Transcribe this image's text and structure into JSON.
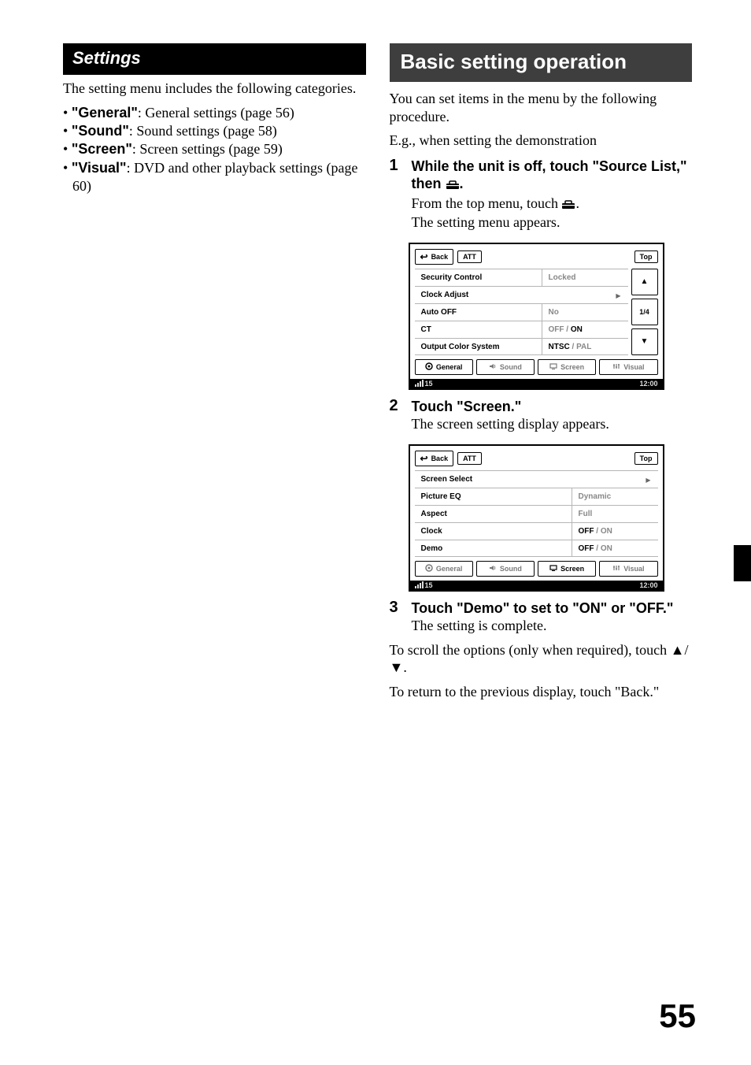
{
  "left": {
    "section_title": "Settings",
    "intro": "The setting menu includes the following categories.",
    "items": [
      {
        "name": "\"General\"",
        "desc": ": General settings (page 56)"
      },
      {
        "name": "\"Sound\"",
        "desc": ": Sound settings (page 58)"
      },
      {
        "name": "\"Screen\"",
        "desc": ": Screen settings (page 59)"
      },
      {
        "name": "\"Visual\"",
        "desc": ": DVD and other playback settings (page 60)"
      }
    ]
  },
  "right": {
    "main_title": "Basic setting operation",
    "intro1": "You can set items in the menu by the following procedure.",
    "intro2": "E.g., when setting the demonstration",
    "step1_head_a": "While the unit is off, touch \"Source List,\" then ",
    "step1_head_b": ".",
    "step1_body_a": "From the top menu, touch ",
    "step1_body_b": ".",
    "step1_body2": "The setting menu appears.",
    "step2_head": "Touch \"Screen.\"",
    "step2_body": "The screen setting display appears.",
    "step3_head": "Touch \"Demo\" to set to \"ON\" or \"OFF.\"",
    "step3_body": "The setting is complete.",
    "footer1": "To scroll the options (only when required), touch ▲/▼.",
    "footer2": "To return to the previous display, touch \"Back.\""
  },
  "shot_common": {
    "back": "Back",
    "att": "ATT",
    "top": "Top",
    "tabs": {
      "general": "General",
      "sound": "Sound",
      "screen": "Screen",
      "visual": "Visual"
    },
    "signal": "15",
    "clock": "12:00"
  },
  "shot1": {
    "rows": [
      {
        "name": "Security Control",
        "value": "Locked",
        "value_mode": "dim"
      },
      {
        "name": "Clock Adjust",
        "play": true
      },
      {
        "name": "Auto OFF",
        "value": "No",
        "value_mode": "dim"
      },
      {
        "name": "CT",
        "value_off": "OFF",
        "value_on": "ON",
        "sep": " / "
      },
      {
        "name": "Output Color System",
        "value_off": "NTSC",
        "value_on": "PAL",
        "sep": " / ",
        "active_first": true
      }
    ],
    "page_indicator": "1/4",
    "active_tab": "general"
  },
  "shot2": {
    "rows": [
      {
        "name": "Screen Select",
        "play": true
      },
      {
        "name": "Picture EQ",
        "value": "Dynamic",
        "value_mode": "dim"
      },
      {
        "name": "Aspect",
        "value": "Full",
        "value_mode": "dim"
      },
      {
        "name": "Clock",
        "value_off": "OFF",
        "value_on": "ON",
        "sep": " / ",
        "active_first": true
      },
      {
        "name": "Demo",
        "value_off": "OFF",
        "value_on": "ON",
        "sep": " / ",
        "active_first": true
      }
    ],
    "active_tab": "screen"
  },
  "pagenum": "55"
}
